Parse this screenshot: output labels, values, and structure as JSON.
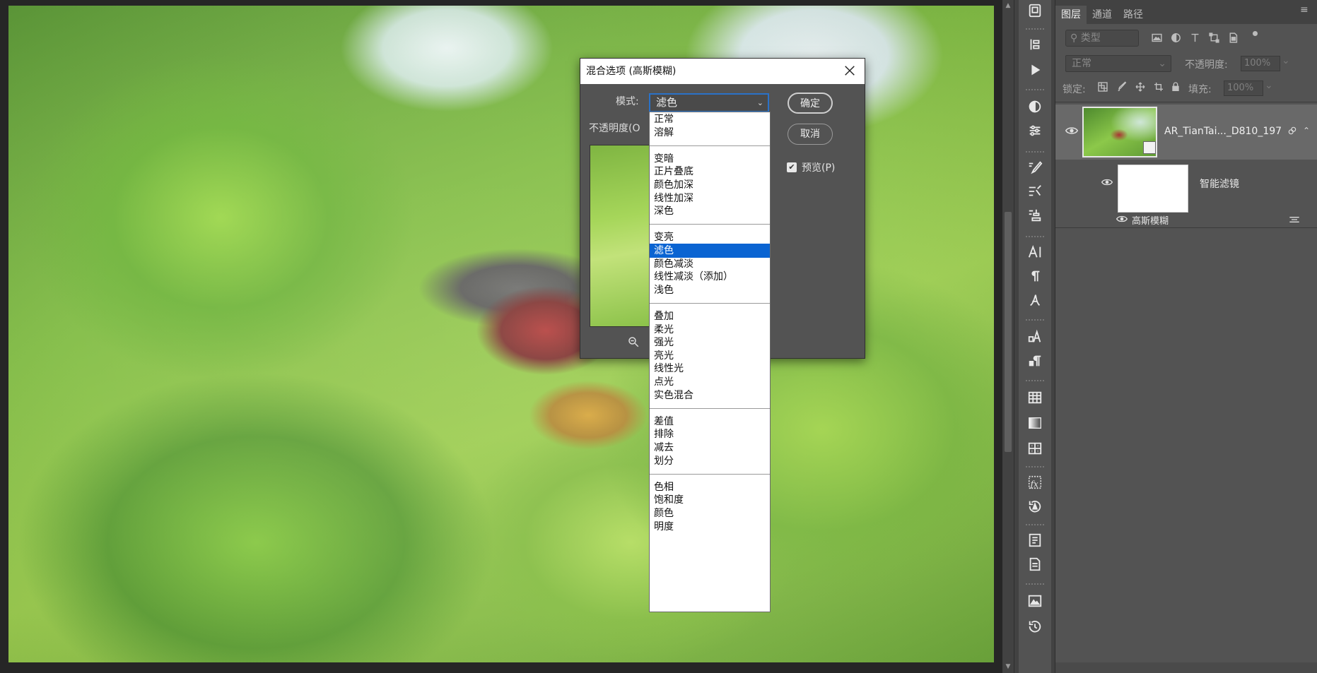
{
  "dialog": {
    "title": "混合选项 (高斯模糊)",
    "mode_label": "模式:",
    "mode_value": "滤色",
    "opacity_label": "不透明度(O",
    "ok_button": "确定",
    "cancel_button": "取消",
    "preview_label": "预览(P)",
    "preview_checked": true
  },
  "blend_modes": [
    [
      "正常",
      "溶解"
    ],
    [
      "变暗",
      "正片叠底",
      "颜色加深",
      "线性加深",
      "深色"
    ],
    [
      "变亮",
      "滤色",
      "颜色减淡",
      "线性减淡（添加）",
      "浅色"
    ],
    [
      "叠加",
      "柔光",
      "强光",
      "亮光",
      "线性光",
      "点光",
      "实色混合"
    ],
    [
      "差值",
      "排除",
      "减去",
      "划分"
    ],
    [
      "色相",
      "饱和度",
      "颜色",
      "明度"
    ]
  ],
  "selected_mode": "滤色",
  "panel": {
    "tabs": [
      "图层",
      "通道",
      "路径"
    ],
    "active_tab": "图层",
    "filter_placeholder": "类型",
    "blend_mode": "正常",
    "opacity_label": "不透明度:",
    "opacity_value": "100%",
    "lock_label": "锁定:",
    "fill_label": "填充:",
    "fill_value": "100%"
  },
  "layers": {
    "main_name": "AR_TianTai..._D810_197",
    "smart_filter_label": "智能滤镜",
    "filter_name": "高斯模糊"
  },
  "colors": {
    "panel_bg": "#535353",
    "selection_blue": "#0a64d2",
    "focus_border": "#2a72c8"
  }
}
